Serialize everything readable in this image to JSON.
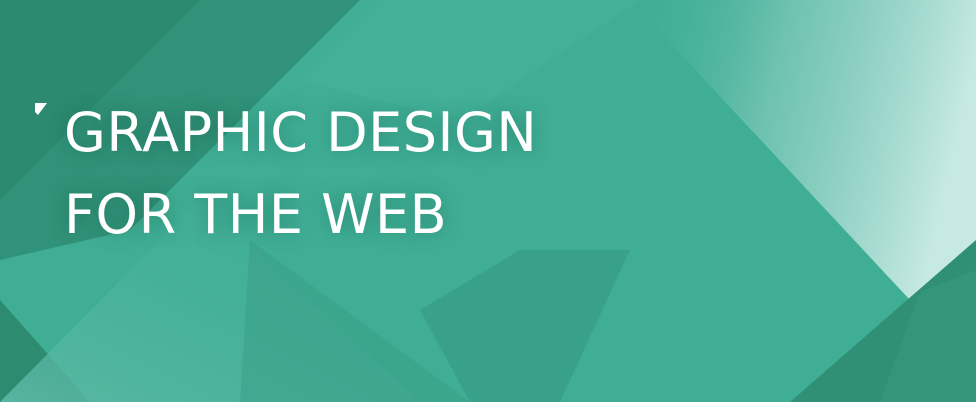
{
  "banner": {
    "title_line_1": "GRAPHIC DESIGN",
    "title_line_2": "FOR THE WEB",
    "icon": "corner-bracket-icon"
  },
  "colors": {
    "base_teal": "#3fae95",
    "dark_teal": "#2e8c70",
    "light_teal": "#b6e2da",
    "text": "#ffffff"
  }
}
